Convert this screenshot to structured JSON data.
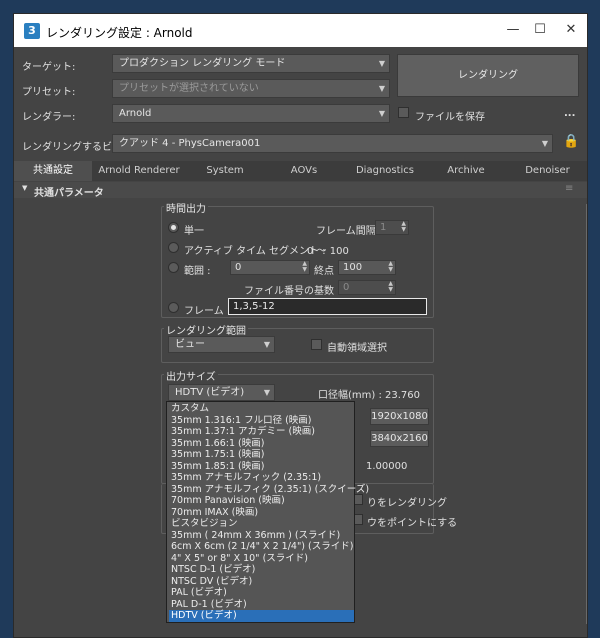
{
  "window": {
    "title": "レンダリング設定 : Arnold",
    "app_icon": "3"
  },
  "controls": {
    "target_label": "ターゲット:",
    "target_value": "プロダクション レンダリング モード",
    "preset_label": "プリセット:",
    "preset_value": "プリセットが選択されていない",
    "renderer_label": "レンダラー:",
    "renderer_value": "Arnold",
    "save_file_label": "ファイルを保存",
    "more_label": "...",
    "render_button": "レンダリング",
    "view_label": "レンダリングするビュー:",
    "view_value": "クアッド 4 - PhysCamera001"
  },
  "tabs": [
    "共通設定",
    "Arnold Renderer",
    "System",
    "AOVs",
    "Diagnostics",
    "Archive",
    "Denoiser"
  ],
  "rollout": {
    "title": "共通パラメータ"
  },
  "time_output": {
    "title": "時間出力",
    "single": "単一",
    "frame_interval_label": "フレーム間隔 :",
    "frame_interval_value": "1",
    "active_segment": "アクティブ タイム セグメント :",
    "active_segment_value": "0 〜 100",
    "range": "範囲 :",
    "range_start": "0",
    "range_end_label": "終点",
    "range_end": "100",
    "file_number_label": "ファイル番号の基数 :",
    "file_number_value": "0",
    "frames": "フレーム :",
    "frames_value": "1,3,5-12"
  },
  "render_area": {
    "title": "レンダリング範囲",
    "value": "ビュー",
    "auto_region": "自動領域選択"
  },
  "output_size": {
    "title": "出力サイズ",
    "preset": "HDTV (ビデオ)",
    "aperture": "口径幅(mm) : 23.760",
    "res1": "1920x1080",
    "res2": "3840x2160",
    "aspect": "1.00000",
    "partial_a": "りをレンダリング",
    "partial_b": "ウをポイントにする"
  },
  "dropdown_items": [
    "カスタム",
    "35mm 1.316:1 フル口径 (映画)",
    "35mm 1.37:1 アカデミー (映画)",
    "35mm 1.66:1 (映画)",
    "35mm 1.75:1 (映画)",
    "35mm 1.85:1 (映画)",
    "35mm アナモルフィック (2.35:1)",
    "35mm アナモルフィク (2.35:1) (スクイーズ)",
    "70mm Panavision (映画)",
    "70mm IMAX (映画)",
    "ビスタビジョン",
    "35mm ( 24mm X 36mm ) (スライド)",
    "6cm X 6cm (2 1/4\" X 2 1/4\") (スライド)",
    "4\" X 5\" or 8\" X 10\" (スライド)",
    "NTSC D-1 (ビデオ)",
    "NTSC DV (ビデオ)",
    "PAL (ビデオ)",
    "PAL D-1 (ビデオ)",
    "HDTV (ビデオ)"
  ],
  "colors": {
    "accent": "#2a6fb8",
    "window_bg": "#444444"
  }
}
